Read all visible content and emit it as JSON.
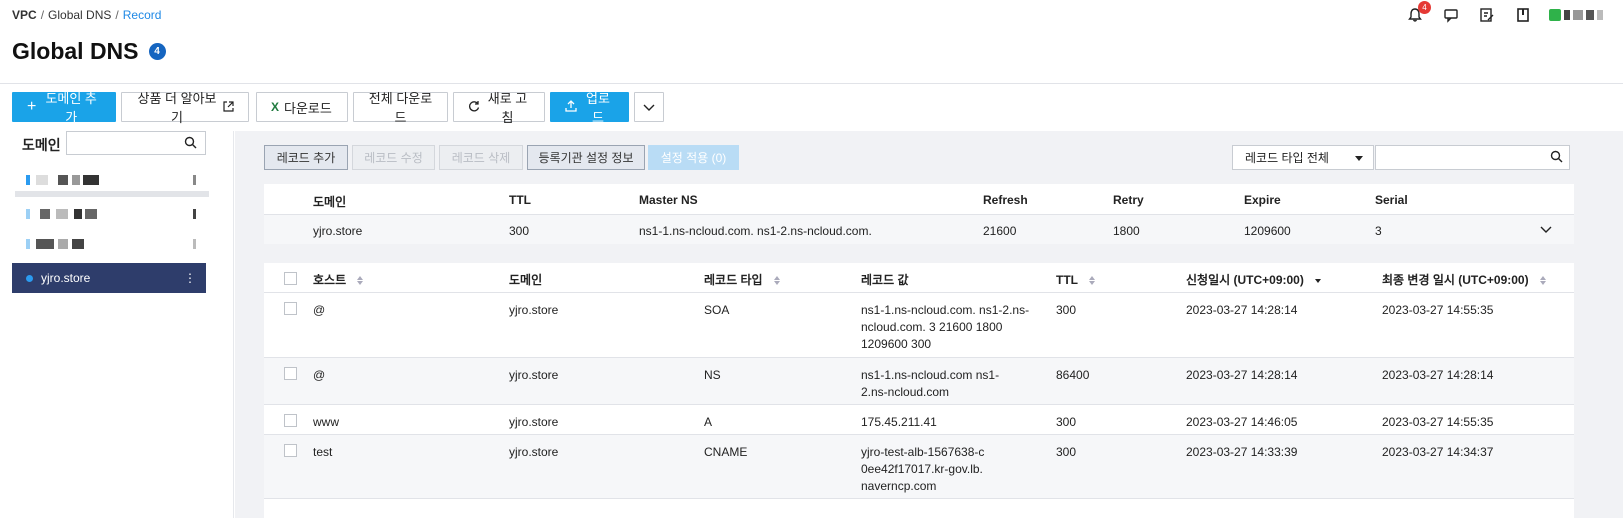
{
  "breadcrumb": {
    "root": "VPC",
    "middle": "Global DNS",
    "current": "Record",
    "sep": "/"
  },
  "page": {
    "title": "Global DNS",
    "badge": "4"
  },
  "top_icons": {
    "notification_count": "4"
  },
  "toolbar": {
    "add_domain": "도메인 추가",
    "learn_more": "상품 더 알아보기",
    "download": "다운로드",
    "download_all": "전체 다운로드",
    "refresh": "새로 고침",
    "upload": "업로드"
  },
  "sidebar": {
    "label": "도메인",
    "search_placeholder": "",
    "selected_domain": "yjro.store"
  },
  "record_toolbar": {
    "add": "레코드 추가",
    "edit": "레코드 수정",
    "delete": "레코드 삭제",
    "registrar": "등록기관 설정 정보",
    "apply": "설정 적용 (0)",
    "type_filter": "레코드 타입 전체",
    "search_placeholder": ""
  },
  "soa_table": {
    "headers": [
      "도메인",
      "TTL",
      "Master NS",
      "Refresh",
      "Retry",
      "Expire",
      "Serial"
    ],
    "row": [
      "yjro.store",
      "300",
      "ns1-1.ns-ncloud.com. ns1-2.ns-ncloud.com.",
      "21600",
      "1800",
      "1209600",
      "3"
    ]
  },
  "record_table": {
    "headers": [
      "호스트",
      "도메인",
      "레코드 타입",
      "레코드 값",
      "TTL",
      "신청일시 (UTC+09:00)",
      "최종 변경 일시 (UTC+09:00)"
    ],
    "rows": [
      [
        "@",
        "yjro.store",
        "SOA",
        "ns1-1.ns-ncloud.com. ns1-2.ns-ncloud.com. 3 21600 1800 1209600 300",
        "300",
        "2023-03-27 14:28:14",
        "2023-03-27 14:55:35"
      ],
      [
        "@",
        "yjro.store",
        "NS",
        "ns1-1.ns-ncloud.com ns1-2.ns-ncloud.com",
        "86400",
        "2023-03-27 14:28:14",
        "2023-03-27 14:28:14"
      ],
      [
        "www",
        "yjro.store",
        "A",
        "175.45.211.41",
        "300",
        "2023-03-27 14:46:05",
        "2023-03-27 14:55:35"
      ],
      [
        "test",
        "yjro.store",
        "CNAME",
        "yjro-test-alb-1567638-c0ee42f17017.kr-gov.lb.naverncp.com",
        "300",
        "2023-03-27 14:33:39",
        "2023-03-27 14:34:37"
      ]
    ]
  }
}
